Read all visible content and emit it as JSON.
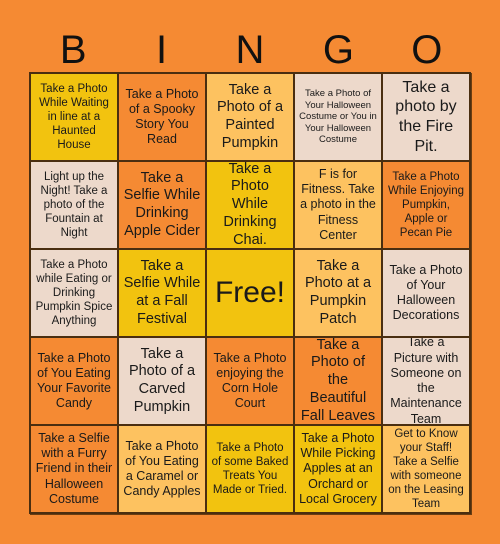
{
  "header": {
    "letters": [
      "B",
      "I",
      "N",
      "G",
      "O"
    ]
  },
  "colors": {
    "background": "#F58A33",
    "yellow": "#F2C30F",
    "orange": "#F58A33",
    "light_orange": "#FDC260",
    "beige": "#EDD9CB"
  },
  "board": {
    "rows": [
      [
        {
          "text": "Take a Photo While Waiting in line at a Haunted House",
          "color": "yellow"
        },
        {
          "text": "Take a Photo of a Spooky Story You Read",
          "color": "orange"
        },
        {
          "text": "Take a Photo of a Painted Pumpkin",
          "color": "light_orange"
        },
        {
          "text": "Take a Photo of Your Halloween Costume or You in Your Halloween Costume",
          "color": "beige"
        },
        {
          "text": "Take a photo by the Fire Pit.",
          "color": "beige"
        }
      ],
      [
        {
          "text": "Light up the Night! Take a photo of the Fountain at Night",
          "color": "beige"
        },
        {
          "text": "Take a Selfie While Drinking Apple Cider",
          "color": "orange"
        },
        {
          "text": "Take a Photo While Drinking Chai.",
          "color": "yellow"
        },
        {
          "text": "F is for Fitness. Take a photo in the Fitness Center",
          "color": "light_orange"
        },
        {
          "text": "Take a Photo While Enjoying Pumpkin, Apple or Pecan Pie",
          "color": "orange"
        }
      ],
      [
        {
          "text": "Take a Photo while Eating or Drinking Pumpkin Spice Anything",
          "color": "beige"
        },
        {
          "text": "Take a Selfie While at a Fall Festival",
          "color": "yellow"
        },
        {
          "text": "Free!",
          "color": "yellow"
        },
        {
          "text": "Take a Photo at a Pumpkin Patch",
          "color": "light_orange"
        },
        {
          "text": "Take a Photo of Your Halloween Decorations",
          "color": "beige"
        }
      ],
      [
        {
          "text": "Take a Photo of You Eating Your Favorite Candy",
          "color": "orange"
        },
        {
          "text": "Take a Photo of a Carved Pumpkin",
          "color": "beige"
        },
        {
          "text": "Take a Photo enjoying the Corn Hole Court",
          "color": "orange"
        },
        {
          "text": "Take a Photo of the Beautiful Fall Leaves",
          "color": "orange"
        },
        {
          "text": "Take a Picture with Someone on the Maintenance Team",
          "color": "beige"
        }
      ],
      [
        {
          "text": "Take a Selfie with a Furry Friend in their Halloween Costume",
          "color": "orange"
        },
        {
          "text": "Take a Photo of You Eating a Caramel or Candy Apples",
          "color": "light_orange"
        },
        {
          "text": "Take a Photo of some Baked Treats You Made or Tried.",
          "color": "yellow"
        },
        {
          "text": "Take a Photo While Picking Apples at an Orchard or Local Grocery",
          "color": "yellow"
        },
        {
          "text": "Get to Know your Staff! Take a Selfie with someone on the Leasing Team",
          "color": "light_orange"
        }
      ]
    ]
  }
}
